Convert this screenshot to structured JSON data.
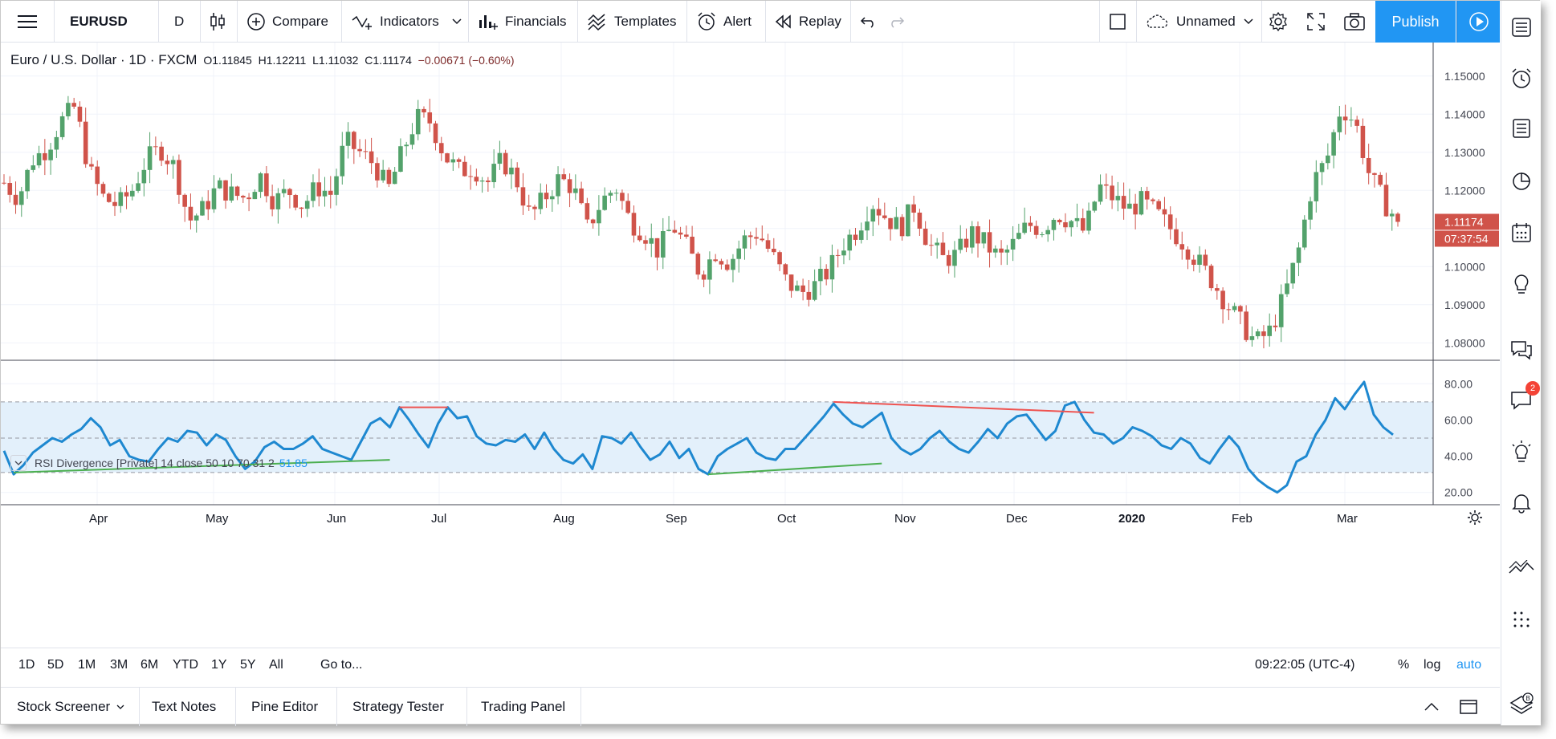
{
  "toolbar": {
    "symbol": "EURUSD",
    "interval": "D",
    "compare_label": "Compare",
    "indicators_label": "Indicators",
    "financials_label": "Financials",
    "templates_label": "Templates",
    "alert_label": "Alert",
    "replay_label": "Replay",
    "layout_name": "Unnamed",
    "publish_label": "Publish"
  },
  "legend": {
    "title": "Euro / U.S. Dollar · 1D · FXCM",
    "o": "O1.11845",
    "h": "H1.12211",
    "l": "L1.11032",
    "c": "C1.11174",
    "change": "−0.00671 (−0.60%)"
  },
  "rsi_legend": {
    "title": "RSI Divergence [Private] 14 close 50 10 70 31 2",
    "value": "51.85"
  },
  "price_axis": {
    "labels": [
      "1.15000",
      "1.14000",
      "1.13000",
      "1.12000",
      "1.10000",
      "1.09000",
      "1.08000"
    ],
    "last_price": "1.11174",
    "countdown": "07:37:54"
  },
  "rsi_axis": {
    "labels": [
      "80.00",
      "60.00",
      "40.00",
      "20.00"
    ]
  },
  "time_axis": {
    "labels": [
      "Apr",
      "May",
      "Jun",
      "Jul",
      "Aug",
      "Sep",
      "Oct",
      "Nov",
      "Dec",
      "2020",
      "Feb",
      "Mar"
    ]
  },
  "range_bar": {
    "ranges": [
      "1D",
      "5D",
      "1M",
      "3M",
      "6M",
      "YTD",
      "1Y",
      "5Y",
      "All"
    ],
    "goto_label": "Go to...",
    "clock": "09:22:05 (UTC-4)",
    "percent_label": "%",
    "log_label": "log",
    "auto_label": "auto"
  },
  "bottom_tabs": [
    "Stock Screener",
    "Text Notes",
    "Pine Editor",
    "Strategy Tester",
    "Trading Panel"
  ],
  "sidebar": {
    "chat_badge": "2"
  },
  "colors": {
    "up": "#53a26b",
    "down": "#d0534a",
    "rsi_line": "#1e88d0",
    "accent": "#2196f3",
    "bull_div": "#4caf50",
    "bear_div": "#ef5350",
    "rsi_band": "#e3f0fb"
  },
  "chart_data": [
    {
      "type": "candlestick",
      "title": "Euro / U.S. Dollar · 1D · FXCM",
      "ylim": [
        1.075,
        1.155
      ],
      "x_labels": [
        "Apr",
        "May",
        "Jun",
        "Jul",
        "Aug",
        "Sep",
        "Oct",
        "Nov",
        "Dec",
        "2020",
        "Feb",
        "Mar"
      ],
      "close_path": [
        1.122,
        1.118,
        1.128,
        1.131,
        1.138,
        1.142,
        1.125,
        1.118,
        1.116,
        1.12,
        1.128,
        1.131,
        1.126,
        1.112,
        1.115,
        1.121,
        1.119,
        1.118,
        1.124,
        1.117,
        1.12,
        1.116,
        1.121,
        1.119,
        1.133,
        1.13,
        1.127,
        1.12,
        1.13,
        1.139,
        1.138,
        1.129,
        1.125,
        1.126,
        1.122,
        1.128,
        1.123,
        1.113,
        1.118,
        1.123,
        1.121,
        1.11,
        1.117,
        1.121,
        1.112,
        1.109,
        1.104,
        1.111,
        1.105,
        1.098,
        1.104,
        1.101,
        1.107,
        1.109,
        1.103,
        1.096,
        1.093,
        1.095,
        1.099,
        1.106,
        1.11,
        1.117,
        1.113,
        1.11,
        1.116,
        1.106,
        1.102,
        1.103,
        1.109,
        1.106,
        1.102,
        1.106,
        1.111,
        1.11,
        1.114,
        1.112,
        1.109,
        1.121,
        1.118,
        1.115,
        1.117,
        1.114,
        1.11,
        1.106,
        1.101,
        1.096,
        1.09,
        1.085,
        1.08,
        1.083,
        1.092,
        1.104,
        1.122,
        1.128,
        1.142,
        1.138,
        1.124,
        1.117,
        1.112
      ],
      "last": 1.11174
    },
    {
      "type": "line",
      "title": "RSI Divergence [Private] 14 close 50 10 70 31 2",
      "ylim": [
        15,
        85
      ],
      "levels": [
        70,
        50,
        31
      ],
      "x_labels": [
        "Apr",
        "May",
        "Jun",
        "Jul",
        "Aug",
        "Sep",
        "Oct",
        "Nov",
        "Dec",
        "2020",
        "Feb",
        "Mar"
      ],
      "values": [
        43,
        30,
        35,
        42,
        46,
        50,
        48,
        52,
        55,
        61,
        56,
        46,
        49,
        40,
        38,
        37,
        44,
        50,
        48,
        54,
        53,
        46,
        52,
        49,
        40,
        33,
        37,
        45,
        48,
        44,
        44,
        47,
        51,
        44,
        42,
        40,
        38,
        48,
        58,
        61,
        56,
        67,
        60,
        52,
        45,
        58,
        67,
        61,
        62,
        51,
        47,
        46,
        49,
        48,
        52,
        44,
        53,
        44,
        38,
        36,
        41,
        33,
        51,
        50,
        47,
        53,
        45,
        38,
        41,
        48,
        39,
        44,
        33,
        30,
        40,
        44,
        47,
        50,
        42,
        39,
        38,
        44,
        44,
        50,
        56,
        62,
        69,
        63,
        58,
        56,
        60,
        64,
        50,
        44,
        41,
        44,
        50,
        54,
        48,
        44,
        42,
        48,
        55,
        50,
        58,
        62,
        63,
        56,
        49,
        54,
        68,
        70,
        60,
        53,
        52,
        47,
        50,
        56,
        54,
        51,
        46,
        44,
        50,
        47,
        39,
        36,
        44,
        51,
        45,
        33,
        27,
        23,
        20,
        24,
        37,
        40,
        52,
        60,
        72,
        66,
        74,
        81,
        63,
        56,
        51.85
      ],
      "divergences": [
        {
          "kind": "bullish",
          "rsi_from": 31,
          "rsi_to": 38
        },
        {
          "kind": "bearish",
          "rsi_from": 67,
          "rsi_to": 67
        },
        {
          "kind": "bullish",
          "rsi_from": 30,
          "rsi_to": 36
        },
        {
          "kind": "bearish",
          "rsi_from": 70,
          "rsi_to": 64
        }
      ]
    }
  ]
}
